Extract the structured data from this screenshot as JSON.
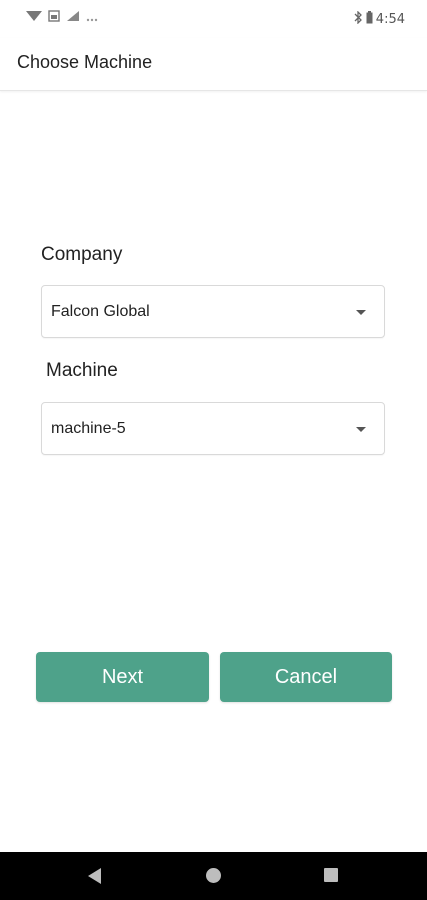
{
  "status_bar": {
    "time": "4:54",
    "icons": [
      "wifi-icon",
      "signal-icon",
      "more-icon",
      "bluetooth-icon",
      "battery-icon"
    ]
  },
  "app_bar": {
    "title": "Choose Machine"
  },
  "form": {
    "company": {
      "label": "Company",
      "selected": "Falcon Global"
    },
    "machine": {
      "label": "Machine",
      "selected": "machine-5"
    }
  },
  "actions": {
    "next_label": "Next",
    "cancel_label": "Cancel"
  },
  "colors": {
    "accent": "#4ea28a",
    "nav_bar": "#000000",
    "background": "#ffffff"
  },
  "nav_bar": {
    "icons": [
      "back-icon",
      "home-icon",
      "recents-icon"
    ]
  }
}
